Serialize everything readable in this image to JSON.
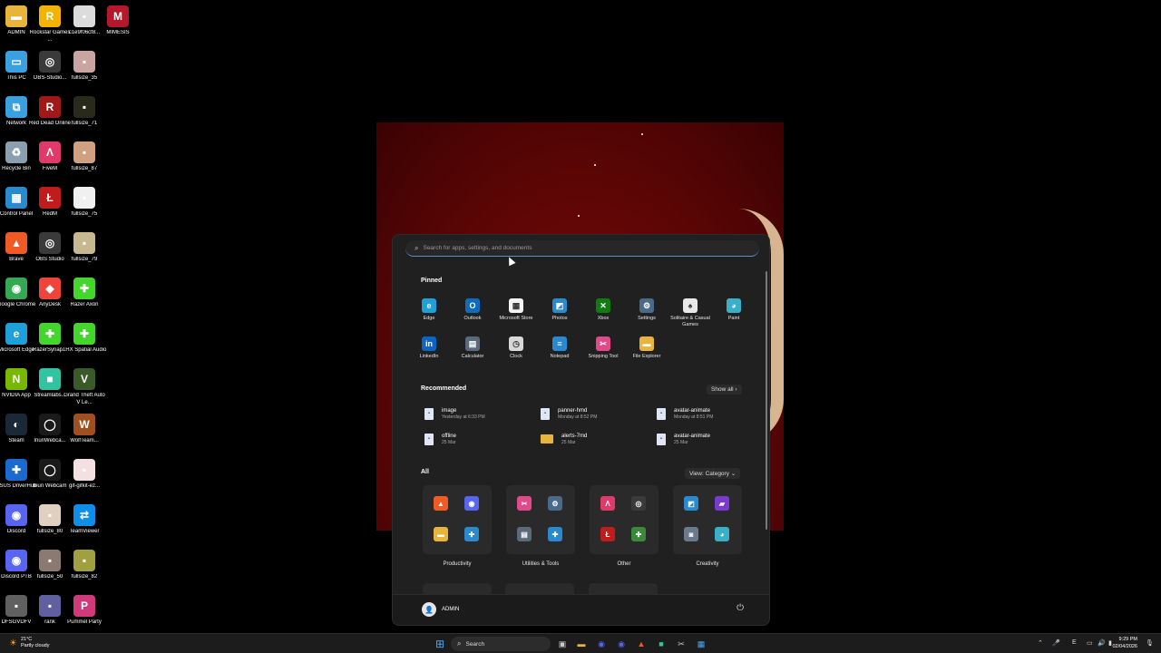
{
  "desktop": {
    "icons": [
      {
        "label": "ADMIN",
        "icon": "folder-icon",
        "color": "#e8b43c"
      },
      {
        "label": "Rockstar Games ...",
        "icon": "rockstar-icon",
        "color": "#f2b400"
      },
      {
        "label": "c1e9f06cf8...",
        "icon": "image-icon",
        "color": "#dcdcdc"
      },
      {
        "label": "MIMESIS",
        "icon": "mimesis-icon",
        "color": "#b5172b"
      },
      {
        "label": "This PC",
        "icon": "monitor-icon",
        "color": "#3aa0e0"
      },
      {
        "label": "OBS-Studio...",
        "icon": "obs-icon",
        "color": "#3a3a3a"
      },
      {
        "label": "fullsize_35",
        "icon": "image-icon",
        "color": "#c9a4a0"
      },
      {
        "label": "Network",
        "icon": "network-icon",
        "color": "#3aa0e0"
      },
      {
        "label": "Red Dead Online",
        "icon": "rdo-icon",
        "color": "#a01818"
      },
      {
        "label": "fullsize_71",
        "icon": "image-icon",
        "color": "#2a2a1a"
      },
      {
        "label": "Recycle Bin",
        "icon": "recycle-bin-icon",
        "color": "#8aa0b0"
      },
      {
        "label": "FiveM",
        "icon": "fivem-icon",
        "color": "#e03a6a"
      },
      {
        "label": "fullsize_87",
        "icon": "image-icon",
        "color": "#d0a080"
      },
      {
        "label": "Control Panel",
        "icon": "control-panel-icon",
        "color": "#2a8ad0"
      },
      {
        "label": "RedM",
        "icon": "redm-icon",
        "color": "#c01c1c"
      },
      {
        "label": "fullsize_75",
        "icon": "image-icon",
        "color": "#f0f0f0"
      },
      {
        "label": "Brave",
        "icon": "brave-icon",
        "color": "#f05a24"
      },
      {
        "label": "OBS Studio",
        "icon": "obs-icon",
        "color": "#3a3a3a"
      },
      {
        "label": "fullsize_79",
        "icon": "image-icon",
        "color": "#c8b890"
      },
      {
        "label": "Google Chrome",
        "icon": "chrome-icon",
        "color": "#34a853"
      },
      {
        "label": "AnyDesk",
        "icon": "anydesk-icon",
        "color": "#ef443b"
      },
      {
        "label": "Razer Axon",
        "icon": "razer-axon-icon",
        "color": "#44d62c"
      },
      {
        "label": "Microsoft Edge",
        "icon": "edge-icon",
        "color": "#1fa0d8"
      },
      {
        "label": "RazerSynap...",
        "icon": "razer-synapse-icon",
        "color": "#44d62c"
      },
      {
        "label": "THX Spatial Audio",
        "icon": "thx-icon",
        "color": "#44d62c"
      },
      {
        "label": "NVIDIA App",
        "icon": "nvidia-icon",
        "color": "#76b900"
      },
      {
        "label": "Streamlabs...",
        "icon": "streamlabs-icon",
        "color": "#31c3a2"
      },
      {
        "label": "Grand Theft Auto V Le...",
        "icon": "gta-icon",
        "color": "#3a5a2a"
      },
      {
        "label": "Steam",
        "icon": "steam-icon",
        "color": "#1b2838"
      },
      {
        "label": "IriunWebca...",
        "icon": "iriun-icon",
        "color": "#1a1a1a"
      },
      {
        "label": "WolfTeam...",
        "icon": "wolfteam-icon",
        "color": "#a05020"
      },
      {
        "label": "ASUS DriverHub",
        "icon": "asus-icon",
        "color": "#1a6ad0"
      },
      {
        "label": "Iriun Webcam",
        "icon": "iriun-icon",
        "color": "#1a1a1a"
      },
      {
        "label": "gif-gifkit-ez...",
        "icon": "image-icon",
        "color": "#f4e0e0"
      },
      {
        "label": "Discord",
        "icon": "discord-icon",
        "color": "#5865f2"
      },
      {
        "label": "fullsize_80",
        "icon": "image-icon",
        "color": "#e0d0c0"
      },
      {
        "label": "TeamViewer",
        "icon": "teamviewer-icon",
        "color": "#0e8ee9"
      },
      {
        "label": "Discord PTB",
        "icon": "discord-icon",
        "color": "#5865f2"
      },
      {
        "label": "fullsize_50",
        "icon": "image-icon",
        "color": "#8a7a70"
      },
      {
        "label": "fullsize_82",
        "icon": "image-icon",
        "color": "#a0a040"
      },
      {
        "label": "DFSGVDFV",
        "icon": "image-icon",
        "color": "#606060"
      },
      {
        "label": "rank",
        "icon": "image-icon",
        "color": "#6060a0"
      },
      {
        "label": "Pummel Party",
        "icon": "pummel-party-icon",
        "color": "#d03a7a"
      }
    ]
  },
  "start_menu": {
    "search_placeholder": "Search for apps, settings, and documents",
    "pinned_title": "Pinned",
    "pinned": [
      {
        "label": "Edge",
        "icon": "edge-icon",
        "glyph": "e",
        "color": "#1fa0d8"
      },
      {
        "label": "Outlook",
        "icon": "outlook-icon",
        "glyph": "O",
        "color": "#0f6cbd"
      },
      {
        "label": "Microsoft Store",
        "icon": "store-icon",
        "glyph": "▦",
        "color": "#f4f4f4"
      },
      {
        "label": "Photos",
        "icon": "photos-icon",
        "glyph": "◩",
        "color": "#2a8ad0"
      },
      {
        "label": "Xbox",
        "icon": "xbox-icon",
        "glyph": "✕",
        "color": "#107c10"
      },
      {
        "label": "Settings",
        "icon": "gear-icon",
        "glyph": "⚙",
        "color": "#4a6a8a"
      },
      {
        "label": "Solitaire & Casual Games",
        "icon": "solitaire-icon",
        "glyph": "♠",
        "color": "#e8e8e8"
      },
      {
        "label": "Paint",
        "icon": "paint-icon",
        "glyph": "◕",
        "color": "#3ab0c8"
      },
      {
        "label": "LinkedIn",
        "icon": "linkedin-icon",
        "glyph": "in",
        "color": "#0a66c2"
      },
      {
        "label": "Calculator",
        "icon": "calculator-icon",
        "glyph": "▤",
        "color": "#5a6a7a"
      },
      {
        "label": "Clock",
        "icon": "clock-icon",
        "glyph": "◷",
        "color": "#d8d8d8"
      },
      {
        "label": "Notepad",
        "icon": "notepad-icon",
        "glyph": "≡",
        "color": "#2a8ad0"
      },
      {
        "label": "Snipping Tool",
        "icon": "snipping-tool-icon",
        "glyph": "✂",
        "color": "#e04a8a"
      },
      {
        "label": "File Explorer",
        "icon": "folder-icon",
        "glyph": "▬",
        "color": "#e8b43c"
      }
    ],
    "recommended_title": "Recommended",
    "show_all_label": "Show all",
    "recommended": [
      {
        "name": "image",
        "time": "Yesterday at 6:33 PM",
        "icon": "document-icon"
      },
      {
        "name": "panner-hmd",
        "time": "Monday at 8:52 PM",
        "icon": "document-icon"
      },
      {
        "name": "avatar-animate",
        "time": "Monday at 8:51 PM",
        "icon": "document-icon"
      },
      {
        "name": "offline",
        "time": "25 Mar",
        "icon": "document-icon"
      },
      {
        "name": "alerts-7md",
        "time": "25 Mar",
        "icon": "folder-icon"
      },
      {
        "name": "avatar-animate",
        "time": "25 Mar",
        "icon": "document-icon"
      }
    ],
    "all_title": "All",
    "view_label": "View: Category",
    "categories": [
      {
        "label": "Productivity",
        "apps": [
          {
            "icon": "brave-icon",
            "glyph": "▲",
            "color": "#f05a24"
          },
          {
            "icon": "discord-icon",
            "glyph": "◉",
            "color": "#5865f2"
          },
          {
            "icon": "folder-icon",
            "glyph": "▬",
            "color": "#e8b43c"
          },
          {
            "icon": "widgets-icon",
            "glyph": "✚",
            "color": "#2a8ad0"
          }
        ]
      },
      {
        "label": "Utilities & Tools",
        "apps": [
          {
            "icon": "snipping-tool-icon",
            "glyph": "✂",
            "color": "#e04a8a"
          },
          {
            "icon": "gear-icon",
            "glyph": "⚙",
            "color": "#4a6a8a"
          },
          {
            "icon": "calculator-icon",
            "glyph": "▤",
            "color": "#5a6a7a"
          },
          {
            "icon": "widgets-icon",
            "glyph": "✚",
            "color": "#2a8ad0"
          }
        ]
      },
      {
        "label": "Other",
        "apps": [
          {
            "icon": "fivem-icon",
            "glyph": "Λ",
            "color": "#e03a6a"
          },
          {
            "icon": "obs-icon",
            "glyph": "◎",
            "color": "#3a3a3a"
          },
          {
            "icon": "redm-icon",
            "glyph": "Ł",
            "color": "#c01c1c"
          },
          {
            "icon": "widgets-icon",
            "glyph": "✚",
            "color": "#3a8a3a"
          }
        ]
      },
      {
        "label": "Creativity",
        "apps": [
          {
            "icon": "photos-icon",
            "glyph": "◩",
            "color": "#2a8ad0"
          },
          {
            "icon": "clipchamp-icon",
            "glyph": "▰",
            "color": "#7a3ad0"
          },
          {
            "icon": "camera-icon",
            "glyph": "◙",
            "color": "#6a7a8a"
          },
          {
            "icon": "paint-icon",
            "glyph": "◕",
            "color": "#3ab0c8"
          }
        ]
      }
    ],
    "user_name": "ADMIN"
  },
  "taskbar": {
    "weather_temp": "21°C",
    "weather_desc": "Partly cloudy",
    "search_label": "Search",
    "time": "9:29 PM",
    "date": "02/04/2026",
    "lang": "E"
  }
}
